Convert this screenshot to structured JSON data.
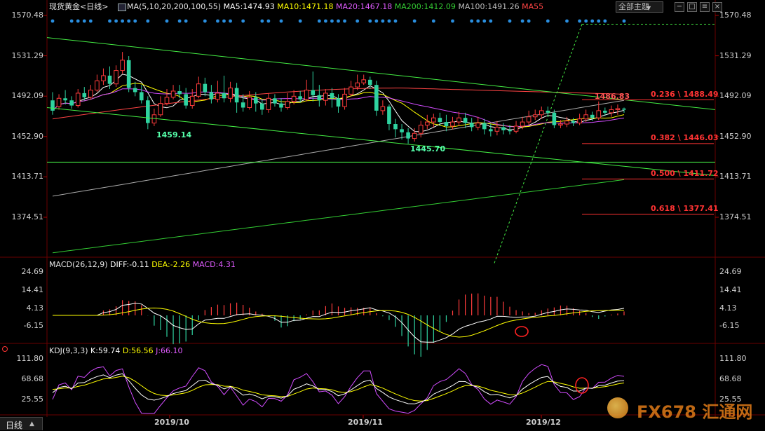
{
  "main_header": {
    "title": "现货黄金",
    "period": "<日线>",
    "ma_params": "MA(5,10,20,200,100,55)",
    "ma5": "MA5:1474.93",
    "ma10": "MA10:1471.18",
    "ma20": "MA20:1467.18",
    "ma200": "MA200:1412.09",
    "ma100": "MA100:1491.26",
    "ma55": "MA55",
    "theme_button": "全部主题"
  },
  "price_axis": {
    "left": [
      "1570.48",
      "1531.29",
      "1492.09",
      "1452.90",
      "1413.71",
      "1374.51"
    ],
    "right": [
      "1570.48",
      "1531.29",
      "1492.09",
      "1452.90",
      "1413.71",
      "1374.51"
    ]
  },
  "annotations": {
    "high_label": "1486.83",
    "low1": "1459.14",
    "low2": "1445.70",
    "fib": [
      "0.236 \\ 1488.49",
      "0.382 \\ 1446.03",
      "0.500 \\ 1411.72",
      "0.618 \\ 1377.41"
    ]
  },
  "macd_header": {
    "label": "MACD(26,12,9)",
    "diff": "DIFF:-0.11",
    "dea": "DEA:-2.26",
    "macd": "MACD:4.31"
  },
  "macd_axis": [
    "24.69",
    "14.41",
    "4.13",
    "-6.15"
  ],
  "kdj_header": {
    "label": "KDJ(9,3,3)",
    "k": "K:59.74",
    "d": "D:56.56",
    "j": "J:66.10"
  },
  "kdj_axis": [
    "111.80",
    "68.68",
    "25.55"
  ],
  "x_axis": [
    "2019/10",
    "2019/11",
    "2019/12"
  ],
  "bottom_tab": "日线",
  "watermark": "FX678 汇通网",
  "colors": {
    "background": "#000000",
    "up": "#ff3c3c",
    "down": "#2fd3a0",
    "ma5": "#ffffff",
    "ma10": "#ffff00",
    "ma20": "#d24cff",
    "ma200": "#33cc33",
    "ma100": "#aaaaaa",
    "ma55": "#ff4444",
    "trend": "#44ee44",
    "fib": "#ff3333"
  },
  "chart_data": {
    "type": "candlestick",
    "x_ticks": [
      "2019/10",
      "2019/11",
      "2019/12"
    ],
    "price_range": [
      1335,
      1580
    ],
    "candles": [
      [
        1488,
        1478,
        1496,
        1474
      ],
      [
        1482,
        1490,
        1494,
        1479
      ],
      [
        1490,
        1488,
        1498,
        1484
      ],
      [
        1488,
        1483,
        1492,
        1480
      ],
      [
        1483,
        1495,
        1499,
        1481
      ],
      [
        1495,
        1491,
        1501,
        1488
      ],
      [
        1491,
        1498,
        1503,
        1489
      ],
      [
        1498,
        1507,
        1513,
        1496
      ],
      [
        1507,
        1512,
        1519,
        1503
      ],
      [
        1512,
        1504,
        1521,
        1499
      ],
      [
        1504,
        1517,
        1522,
        1501
      ],
      [
        1517,
        1527,
        1535,
        1514
      ],
      [
        1527,
        1500,
        1531,
        1496
      ],
      [
        1500,
        1496,
        1506,
        1492
      ],
      [
        1496,
        1488,
        1503,
        1485
      ],
      [
        1488,
        1466,
        1492,
        1460
      ],
      [
        1466,
        1474,
        1480,
        1463
      ],
      [
        1474,
        1485,
        1492,
        1472
      ],
      [
        1485,
        1491,
        1499,
        1483
      ],
      [
        1491,
        1497,
        1503,
        1489
      ],
      [
        1497,
        1494,
        1503,
        1490
      ],
      [
        1494,
        1483,
        1500,
        1480
      ],
      [
        1483,
        1492,
        1499,
        1480
      ],
      [
        1492,
        1504,
        1511,
        1490
      ],
      [
        1504,
        1496,
        1510,
        1492
      ],
      [
        1496,
        1489,
        1503,
        1485
      ],
      [
        1489,
        1495,
        1507,
        1486
      ],
      [
        1495,
        1490,
        1512,
        1486
      ],
      [
        1490,
        1500,
        1506,
        1486
      ],
      [
        1500,
        1486,
        1505,
        1476
      ],
      [
        1486,
        1481,
        1494,
        1477
      ],
      [
        1481,
        1491,
        1497,
        1479
      ],
      [
        1491,
        1485,
        1496,
        1477
      ],
      [
        1485,
        1479,
        1489,
        1474
      ],
      [
        1479,
        1490,
        1495,
        1476
      ],
      [
        1490,
        1485,
        1494,
        1482
      ],
      [
        1485,
        1481,
        1490,
        1477
      ],
      [
        1481,
        1487,
        1495,
        1479
      ],
      [
        1487,
        1492,
        1498,
        1484
      ],
      [
        1492,
        1489,
        1497,
        1486
      ],
      [
        1489,
        1498,
        1508,
        1487
      ],
      [
        1498,
        1493,
        1516,
        1487
      ],
      [
        1493,
        1488,
        1503,
        1482
      ],
      [
        1488,
        1495,
        1499,
        1483
      ],
      [
        1495,
        1490,
        1500,
        1481
      ],
      [
        1490,
        1482,
        1494,
        1476
      ],
      [
        1482,
        1494,
        1500,
        1479
      ],
      [
        1494,
        1501,
        1507,
        1492
      ],
      [
        1501,
        1505,
        1513,
        1498
      ],
      [
        1505,
        1508,
        1513,
        1503
      ],
      [
        1508,
        1503,
        1511,
        1499
      ],
      [
        1503,
        1478,
        1507,
        1473
      ],
      [
        1478,
        1482,
        1488,
        1474
      ],
      [
        1482,
        1465,
        1484,
        1459
      ],
      [
        1465,
        1460,
        1470,
        1452
      ],
      [
        1460,
        1457,
        1465,
        1450
      ],
      [
        1457,
        1451,
        1461,
        1446
      ],
      [
        1451,
        1456,
        1461,
        1448
      ],
      [
        1456,
        1464,
        1468,
        1452
      ],
      [
        1464,
        1467,
        1474,
        1460
      ],
      [
        1467,
        1471,
        1475,
        1462
      ],
      [
        1471,
        1467,
        1476,
        1463
      ],
      [
        1467,
        1463,
        1474,
        1458
      ],
      [
        1463,
        1467,
        1472,
        1460
      ],
      [
        1467,
        1471,
        1477,
        1463
      ],
      [
        1471,
        1466,
        1476,
        1461
      ],
      [
        1466,
        1462,
        1471,
        1458
      ],
      [
        1462,
        1466,
        1472,
        1459
      ],
      [
        1466,
        1460,
        1470,
        1455
      ],
      [
        1460,
        1458,
        1465,
        1453
      ],
      [
        1458,
        1462,
        1468,
        1454
      ],
      [
        1462,
        1459,
        1466,
        1455
      ],
      [
        1459,
        1458,
        1464,
        1455
      ],
      [
        1458,
        1463,
        1468,
        1456
      ],
      [
        1463,
        1467,
        1472,
        1460
      ],
      [
        1467,
        1472,
        1478,
        1464
      ],
      [
        1472,
        1474,
        1479,
        1469
      ],
      [
        1474,
        1478,
        1482,
        1470
      ],
      [
        1478,
        1476,
        1482,
        1472
      ],
      [
        1476,
        1464,
        1479,
        1461
      ],
      [
        1464,
        1465,
        1469,
        1461
      ],
      [
        1465,
        1468,
        1472,
        1462
      ],
      [
        1468,
        1466,
        1471,
        1463
      ],
      [
        1466,
        1470,
        1475,
        1464
      ],
      [
        1470,
        1474,
        1479,
        1467
      ],
      [
        1474,
        1471,
        1477,
        1468
      ],
      [
        1471,
        1478,
        1487,
        1469
      ],
      [
        1478,
        1476,
        1481,
        1473
      ],
      [
        1476,
        1479,
        1483,
        1472
      ],
      [
        1479,
        1480,
        1484,
        1474
      ],
      [
        1480,
        1479,
        1481,
        1476
      ]
    ],
    "fibonacci": [
      {
        "level": 0.236,
        "price": 1488.49
      },
      {
        "level": 0.382,
        "price": 1446.03
      },
      {
        "level": 0.5,
        "price": 1411.72
      },
      {
        "level": 0.618,
        "price": 1377.41
      }
    ],
    "ma_values": {
      "MA5": 1474.93,
      "MA10": 1471.18,
      "MA20": 1467.18,
      "MA200": 1412.09,
      "MA100": 1491.26
    },
    "macd": {
      "DIFF": -0.11,
      "DEA": -2.26,
      "MACD": 4.31,
      "range": [
        -12,
        28
      ]
    },
    "kdj": {
      "K": 59.74,
      "D": 56.56,
      "J": 66.1,
      "range": [
        -5,
        125
      ]
    }
  }
}
